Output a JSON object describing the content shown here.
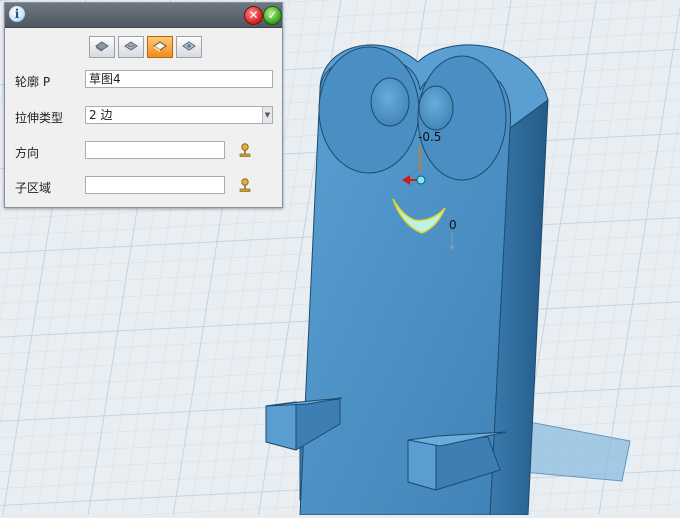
{
  "panel": {
    "mode_buttons": [
      {
        "name": "extrude-add-icon",
        "active": false
      },
      {
        "name": "extrude-subtract-icon",
        "active": false
      },
      {
        "name": "extrude-intersect-icon",
        "active": true
      },
      {
        "name": "extrude-new-body-icon",
        "active": false
      }
    ],
    "fields": {
      "profile": {
        "label": "轮廓 P",
        "value": "草图4"
      },
      "extrude_type": {
        "label": "拉伸类型",
        "value": "2 边"
      },
      "direction": {
        "label": "方向",
        "value": ""
      },
      "sub_region": {
        "label": "子区域",
        "value": ""
      }
    }
  },
  "viewport": {
    "dimension_1": "-0.5",
    "dimension_2": "0",
    "colors": {
      "model_face": "#4a8fc4",
      "model_side": "#2f6d9e",
      "selection": "#bdf3e6",
      "grid_line": "#c9d7e2"
    }
  }
}
